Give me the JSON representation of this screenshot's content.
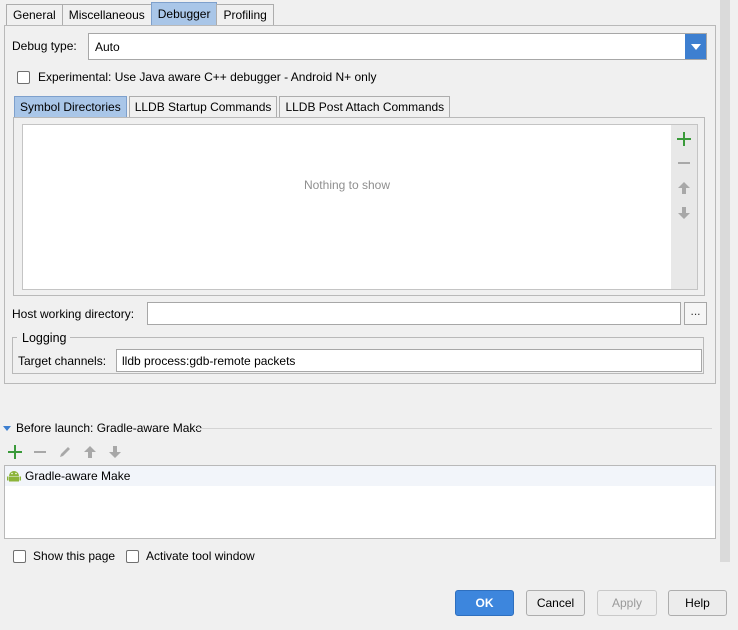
{
  "tabs": [
    "General",
    "Miscellaneous",
    "Debugger",
    "Profiling"
  ],
  "debug_type": {
    "label": "Debug type:",
    "value": "Auto"
  },
  "experimental": {
    "label": "Experimental: Use Java aware C++ debugger - Android N+ only",
    "checked": false
  },
  "inner_tabs": [
    "Symbol Directories",
    "LLDB Startup Commands",
    "LLDB Post Attach Commands"
  ],
  "symbol_list": {
    "empty_text": "Nothing to show"
  },
  "host": {
    "label": "Host working directory:",
    "value": "",
    "browse_label": "..."
  },
  "logging": {
    "title": "Logging",
    "target_label": "Target channels:",
    "target_value": "lldb process:gdb-remote packets"
  },
  "before_launch": {
    "title": "Before launch: Gradle-aware Make",
    "tasks": [
      "Gradle-aware Make"
    ]
  },
  "options": {
    "show_page": "Show this page",
    "activate_tool_window": "Activate tool window"
  },
  "buttons": {
    "ok": "OK",
    "cancel": "Cancel",
    "apply": "Apply",
    "help": "Help"
  },
  "colors": {
    "accent": "#3d86dd",
    "active_tab": "#a9c6e8",
    "add_icon": "#3a9a3a",
    "android": "#8cb43a"
  }
}
